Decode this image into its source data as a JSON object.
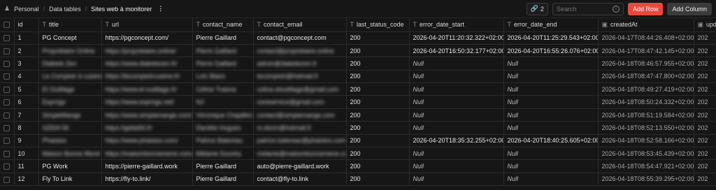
{
  "breadcrumb": {
    "root": "Personal",
    "section": "Data tables",
    "current": "Sites web à monitorer"
  },
  "toolbar": {
    "link_count": "2",
    "search_placeholder": "Search",
    "add_row": "Add Row",
    "add_column": "Add Column"
  },
  "columns": [
    "id",
    "title",
    "url",
    "contact_name",
    "contact_email",
    "last_status_code",
    "error_date_start",
    "error_date_end",
    "createdAt",
    "upd"
  ],
  "rows": [
    {
      "id": "1",
      "title": "PG Concept",
      "url": "https://pgconcept.com/",
      "contact_name": "Pierre Gaillard",
      "contact_email": "contact@pgconcept.com",
      "last_status_code": "200",
      "error_date_start": "2026-04-20T11:20:32.322+02:00",
      "error_date_end": "2026-04-20T11:25:29.543+02:00",
      "createdAt": "2026-04-17T08:44:26.408+02:00",
      "upd": "202"
    },
    {
      "id": "2",
      "title": "Propriétaire Online",
      "url": "https://proprietaire.online/",
      "contact_name": "Pierre Gaillard",
      "contact_email": "contact@proprietaire.online",
      "last_status_code": "200",
      "error_date_start": "2026-04-20T16:50:32.177+02:00",
      "error_date_end": "2026-04-20T16:55:26.076+02:00",
      "createdAt": "2026-04-17T08:47:42.145+02:00",
      "upd": "202"
    },
    {
      "id": "3",
      "title": "Diabete Zen",
      "url": "https://www.diabetezen.fr/",
      "contact_name": "Pierre Gaillard",
      "contact_email": "admin@diabetezen.fr",
      "last_status_code": "200",
      "error_date_start": "Null",
      "error_date_end": "Null",
      "createdAt": "2026-04-18T08:46:57.955+02:00",
      "upd": "202"
    },
    {
      "id": "4",
      "title": "Le Comptoir à cuisine",
      "url": "https://lecomptoircuisine.fr/",
      "contact_name": "Loïc Blanc",
      "contact_email": "lecomptoir@hotmail.fr",
      "last_status_code": "200",
      "error_date_start": "Null",
      "error_date_end": "Null",
      "createdAt": "2026-04-18T08:47:47.800+02:00",
      "upd": "202"
    },
    {
      "id": "5",
      "title": "El Outillage",
      "url": "https://www.el-outillage.fr/",
      "contact_name": "Céline Traisne",
      "contact_email": "celine.eloutillage@gmail.com",
      "last_status_code": "200",
      "error_date_start": "Null",
      "error_date_end": "Null",
      "createdAt": "2026-04-18T08:49:27.419+02:00",
      "upd": "202"
    },
    {
      "id": "6",
      "title": "Esprogo",
      "url": "https://www.esprogo.net/",
      "contact_name": "NJ",
      "contact_email": "nsreservice@gmail.com",
      "last_status_code": "200",
      "error_date_start": "Null",
      "error_date_end": "Null",
      "createdAt": "2026-04-18T08:50:24.332+02:00",
      "upd": "202"
    },
    {
      "id": "7",
      "title": "SimpleMange",
      "url": "https://www.simplemange.com/",
      "contact_name": "Véronique Chapillon",
      "contact_email": "contact@simplemange.com",
      "last_status_code": "200",
      "error_date_start": "Null",
      "error_date_end": "Null",
      "createdAt": "2026-04-18T08:51:19.584+02:00",
      "upd": "202"
    },
    {
      "id": "8",
      "title": "GDDA 56",
      "url": "https://gdda56.fr/",
      "contact_name": "Danièle Hugues",
      "contact_email": "m.dizon@hotmail.fr",
      "last_status_code": "200",
      "error_date_start": "Null",
      "error_date_end": "Null",
      "createdAt": "2026-04-18T08:52:13.550+02:00",
      "upd": "202"
    },
    {
      "id": "9",
      "title": "Phaistos",
      "url": "https://www.phaistos.com/",
      "contact_name": "Patrice Balereau",
      "contact_email": "patrice.balereau@phaistos.com",
      "last_status_code": "200",
      "error_date_start": "2026-04-20T18:35:32.255+02:00",
      "error_date_end": "2026-04-20T18:40:25.605+02:00",
      "createdAt": "2026-04-18T08:52:58.166+02:00",
      "upd": "202"
    },
    {
      "id": "10",
      "title": "Maison Bonne Mené",
      "url": "https://maisonbonnemene.com/",
      "contact_name": "Mélanie Duvoiry",
      "contact_email": "melanie@maisonbonnemene.com",
      "last_status_code": "200",
      "error_date_start": "Null",
      "error_date_end": "Null",
      "createdAt": "2026-04-18T08:53:45.439+02:00",
      "upd": "202"
    },
    {
      "id": "11",
      "title": "PG Work",
      "url": "https://pierre-gaillard.work",
      "contact_name": "Pierre Gaillard",
      "contact_email": "auto@pierre-gaillard.work",
      "last_status_code": "200",
      "error_date_start": "Null",
      "error_date_end": "Null",
      "createdAt": "2026-04-18T08:54:47.921+02:00",
      "upd": "202"
    },
    {
      "id": "12",
      "title": "Fly To Link",
      "url": "https://fly-to.link/",
      "contact_name": "Pierre Gaillard",
      "contact_email": "contact@fly-to.link",
      "last_status_code": "200",
      "error_date_start": "Null",
      "error_date_end": "Null",
      "createdAt": "2026-04-18T08:55:39.295+02:00",
      "upd": "202"
    }
  ]
}
